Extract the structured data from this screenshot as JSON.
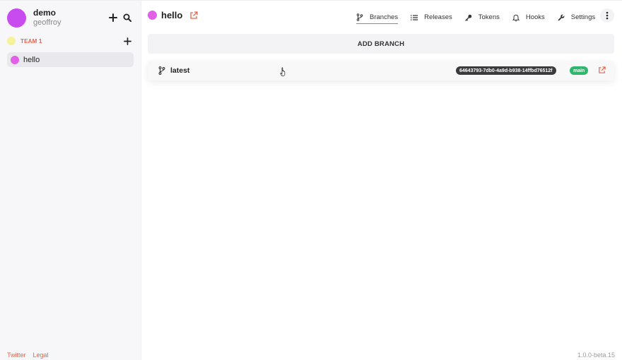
{
  "user": {
    "name": "demo",
    "handle": "geoffroy"
  },
  "team": {
    "label": "TEAM 1"
  },
  "projects": [
    {
      "label": "hello"
    }
  ],
  "footer": {
    "twitter": "Twitter",
    "legal": "Legal"
  },
  "project": {
    "title": "hello"
  },
  "nav": {
    "branches": "Branches",
    "releases": "Releases",
    "tokens": "Tokens",
    "hooks": "Hooks",
    "settings": "Settings"
  },
  "actions": {
    "add_branch": "ADD BRANCH"
  },
  "branches": [
    {
      "name": "latest",
      "release_id": "64643793-7db0-4a9d-b938-14ffbd76512f",
      "badge": "main"
    }
  ],
  "version": "1.0.0-beta.15",
  "colors": {
    "accent": "#e8634a",
    "avatar": "#c84bf0",
    "project": "#e060e6",
    "team": "#f5f39a",
    "badge_main": "#2fb86c"
  }
}
